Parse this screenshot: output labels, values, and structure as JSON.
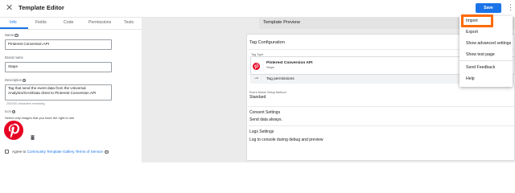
{
  "window": {
    "title": "Template Editor",
    "save_label": "Save"
  },
  "tabs": [
    "Info",
    "Fields",
    "Code",
    "Permissions",
    "Tests"
  ],
  "info": {
    "name_label": "Name",
    "name_value": "Pinterest Conversion API",
    "brand_label": "Brand name",
    "brand_value": "Stape",
    "description_label": "Description",
    "description_value": "Tag that send the event data from the Universal Analytics/GA4/Data client to Pinterest Conversion API",
    "char_count": "200/200 characters remaining",
    "icon_label": "Icon",
    "icon_hint": "Select only images that you have the right to use",
    "agree_prefix": "Agree to",
    "agree_link": "Community Template Gallery Terms of Service"
  },
  "preview": {
    "title": "Template Preview",
    "card_title": "Tag Configuration",
    "tag_type_label": "Tag Type",
    "tag_name": "Pinterest Conversion API",
    "tag_brand": "Stape",
    "tag_permissions": "Tag permissions",
    "method_label": "Event Name Setup Method",
    "method_value": "Standard",
    "consent_title": "Consent Settings",
    "consent_value": "Send data always.",
    "logs_title": "Logs Settings",
    "logs_value": "Log to console during debug and preview"
  },
  "menu": {
    "items": [
      "Import",
      "Export",
      "Show advanced settings",
      "Show test page",
      "Send Feedback",
      "Help"
    ]
  },
  "colors": {
    "accent": "#1a73e8",
    "highlight": "#ff6a00",
    "pinterest": "#e60023"
  }
}
